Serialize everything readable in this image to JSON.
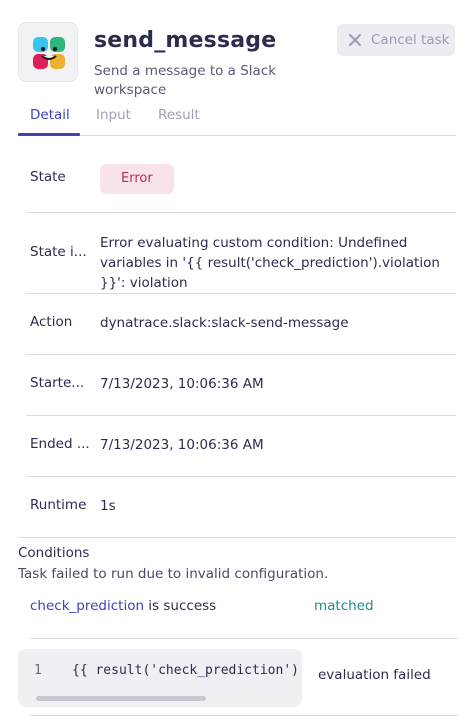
{
  "header": {
    "icon": "slack-icon",
    "title": "send_message",
    "subtitle": "Send a message to a Slack workspace",
    "cancel_label": "Cancel task"
  },
  "tabs": [
    {
      "label": "Detail",
      "active": true
    },
    {
      "label": "Input",
      "active": false
    },
    {
      "label": "Result",
      "active": false
    }
  ],
  "details": {
    "state": {
      "label": "State",
      "value": "Error"
    },
    "state_info": {
      "label": "State i...",
      "value": "Error evaluating custom condition: Undefined variables in '{{ result('check_prediction').violation }}': violation"
    },
    "action": {
      "label": "Action",
      "value": "dynatrace.slack:slack-send-message"
    },
    "started": {
      "label": "Starte...",
      "value": "7/13/2023, 10:06:36 AM"
    },
    "ended": {
      "label": "Ended ...",
      "value": "7/13/2023, 10:06:36 AM"
    },
    "runtime": {
      "label": "Runtime",
      "value": "1s"
    }
  },
  "conditions": {
    "title": "Conditions",
    "description": "Task failed to run due to invalid configuration.",
    "predecessor": {
      "name": "check_prediction",
      "text": " is success",
      "status": "matched"
    },
    "custom": {
      "line_number": "1",
      "code": "{{ result('check_prediction').violation }}",
      "status": "evaluation failed"
    }
  },
  "colors": {
    "accent": "#3f43b8",
    "error_bg": "#f7e3e8",
    "error_text": "#b0304e",
    "matched": "#1f8b8b"
  }
}
